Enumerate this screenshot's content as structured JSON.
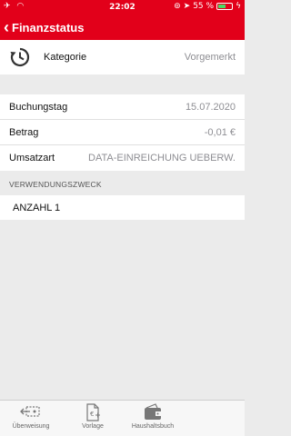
{
  "status_bar": {
    "time": "22:02",
    "battery_percent": "55 %",
    "battery_level": 0.55,
    "left_icons": [
      "airplane-icon",
      "wifi-icon"
    ],
    "right_icons": [
      "orientation-lock-icon",
      "location-icon",
      "charging-icon"
    ]
  },
  "nav": {
    "back_label": "Finanzstatus"
  },
  "kategorie": {
    "label": "Kategorie",
    "value": "Vorgemerkt",
    "icon": "clock-history-icon"
  },
  "details": [
    {
      "label": "Buchungstag",
      "value": "15.07.2020"
    },
    {
      "label": "Betrag",
      "value": "-0,01 €"
    },
    {
      "label": "Umsatzart",
      "value": "DATA-EINREICHUNG UEBERW."
    }
  ],
  "verwendungszweck": {
    "header": "VERWENDUNGSZWECK",
    "text": "ANZAHL 1"
  },
  "tabbar": {
    "tabs": [
      {
        "label": "Überweisung",
        "icon": "transfer-icon"
      },
      {
        "label": "Vorlage",
        "icon": "template-icon"
      },
      {
        "label": "Haushaltsbuch",
        "icon": "wallet-icon"
      }
    ]
  },
  "colors": {
    "brand_red": "#e2001a",
    "battery_green": "#4cd964",
    "secondary_text": "#8e8e93",
    "background": "#ebebeb"
  }
}
